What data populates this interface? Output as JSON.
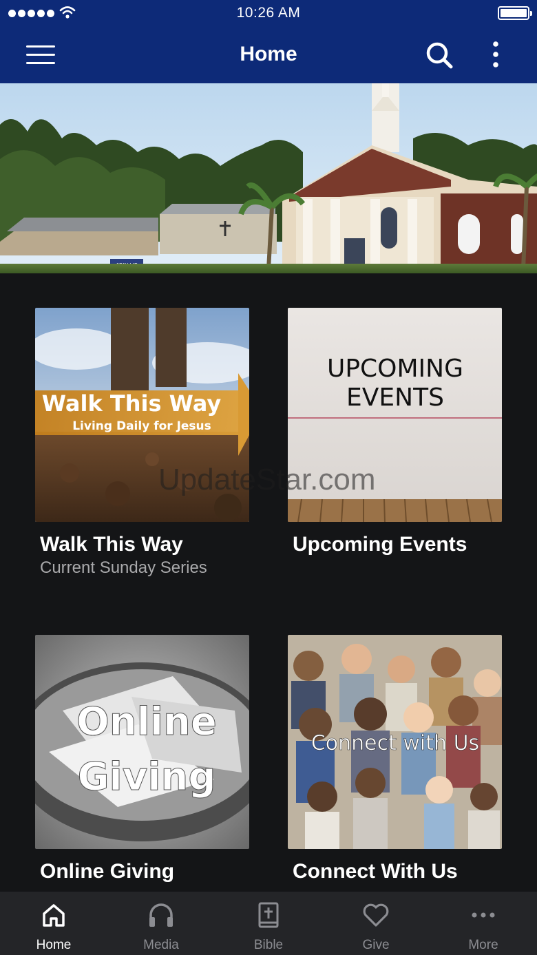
{
  "status_bar": {
    "time": "10:26 AM"
  },
  "header": {
    "title": "Home"
  },
  "hero": {
    "alt": "church building",
    "sign_text": "JOIN US"
  },
  "cards": [
    {
      "title": "Walk This Way",
      "subtitle": "Current Sunday Series",
      "image_title": "Walk This Way",
      "image_subtitle": "Living Daily for Jesus"
    },
    {
      "title": "Upcoming Events",
      "image_line1": "UPCOMING",
      "image_line2": "EVENTS",
      "image_footer": "UpdateStar.com"
    },
    {
      "title": "Online Giving",
      "image_line1": "Online",
      "image_line2": "Giving"
    },
    {
      "title": "Connect With Us",
      "image_title": "Connect with Us"
    }
  ],
  "tabs": [
    {
      "label": "Home",
      "icon": "home-icon",
      "active": true
    },
    {
      "label": "Media",
      "icon": "headphones-icon",
      "active": false
    },
    {
      "label": "Bible",
      "icon": "bible-icon",
      "active": false
    },
    {
      "label": "Give",
      "icon": "heart-icon",
      "active": false
    },
    {
      "label": "More",
      "icon": "more-dots-icon",
      "active": false
    }
  ],
  "colors": {
    "header": "#0d2a78",
    "background": "#141517",
    "tabbar": "#242528",
    "active_tab": "#ffffff",
    "inactive_tab": "#8c8d92"
  }
}
